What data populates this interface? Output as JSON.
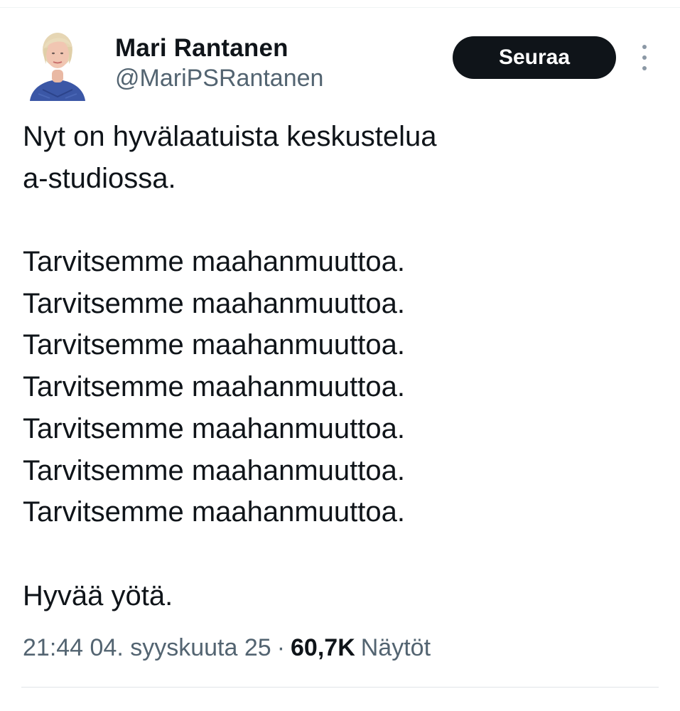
{
  "author": {
    "name": "Mari Rantanen",
    "handle": "@MariPSRantanen"
  },
  "follow_label": "Seuraa",
  "more_icon": "more-vertical-icon",
  "tweet": {
    "intro_lines": [
      "Nyt on hyvälaatuista keskustelua",
      "a-studiossa."
    ],
    "repeated_lines": [
      "Tarvitsemme maahanmuuttoa.",
      "Tarvitsemme maahanmuuttoa.",
      "Tarvitsemme maahanmuuttoa.",
      "Tarvitsemme maahanmuuttoa.",
      "Tarvitsemme maahanmuuttoa.",
      "Tarvitsemme maahanmuuttoa.",
      "Tarvitsemme maahanmuuttoa."
    ],
    "closing_line": "Hyvää yötä."
  },
  "meta": {
    "timestamp": "21:44 04. syyskuuta 25",
    "separator": "·",
    "views_count": "60,7K",
    "views_label": "Näytöt"
  },
  "colors": {
    "text_primary": "#0f1419",
    "text_secondary": "#536471",
    "button_bg": "#0f1419",
    "button_text": "#ffffff"
  }
}
